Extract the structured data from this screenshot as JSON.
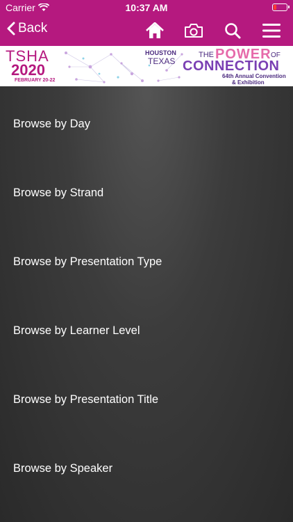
{
  "status_bar": {
    "carrier": "Carrier",
    "time": "10:37 AM"
  },
  "navbar": {
    "back_label": "Back",
    "icons": [
      "home-icon",
      "camera-icon",
      "search-icon",
      "menu-icon"
    ]
  },
  "banner": {
    "event_name": "TSHA",
    "year": "2020",
    "dates": "FEBRUARY 20-22",
    "city": "HOUSTON",
    "state": "TEXAS",
    "tagline_the": "THE",
    "tagline_power": "POWER",
    "tagline_of": "OF",
    "tagline_connection": "CONNECTION",
    "annual": "64th Annual Convention",
    "exhibition": "& Exhibition"
  },
  "menu": {
    "items": [
      "Browse by Day",
      "Browse by Strand",
      "Browse by Presentation Type",
      "Browse by Learner Level",
      "Browse by Presentation Title",
      "Browse by Speaker"
    ]
  },
  "colors": {
    "brand": "#b5197f",
    "background": "#2e2e2e",
    "text": "#ffffff"
  }
}
